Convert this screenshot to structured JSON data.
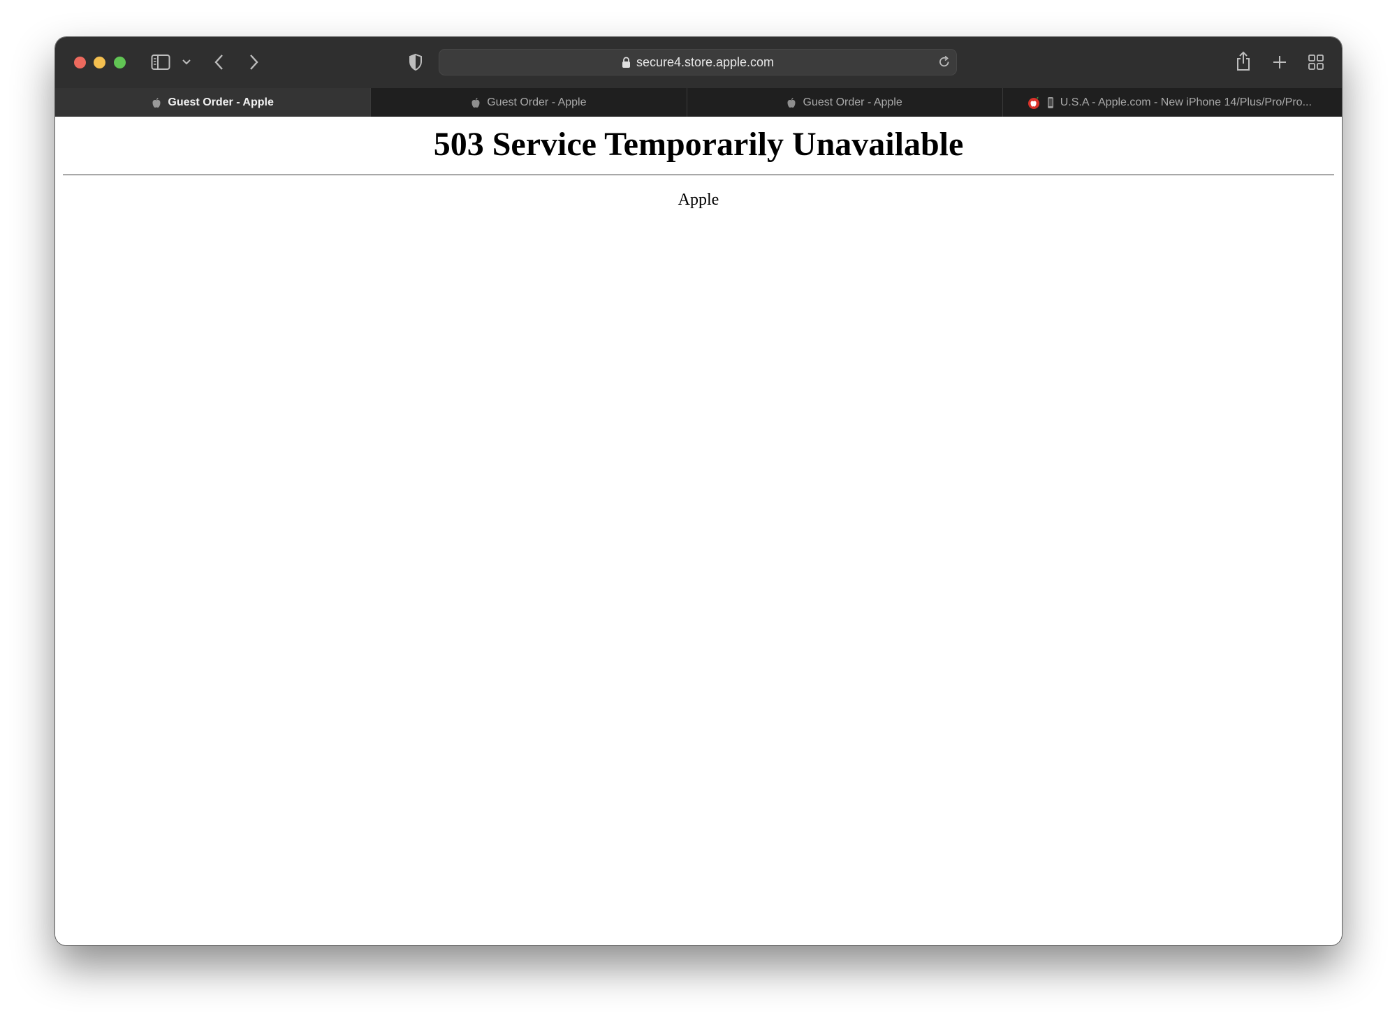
{
  "browser": {
    "address_bar": {
      "url": "secure4.store.apple.com"
    },
    "tabs": [
      {
        "label": "Guest Order - Apple",
        "active": true
      },
      {
        "label": "Guest Order - Apple",
        "active": false
      },
      {
        "label": "Guest Order - Apple",
        "active": false
      },
      {
        "label": "U.S.A - Apple.com - New iPhone 14/Plus/Pro/Pro...",
        "active": false
      }
    ]
  },
  "page": {
    "heading": "503 Service Temporarily Unavailable",
    "server_signature": "Apple"
  }
}
